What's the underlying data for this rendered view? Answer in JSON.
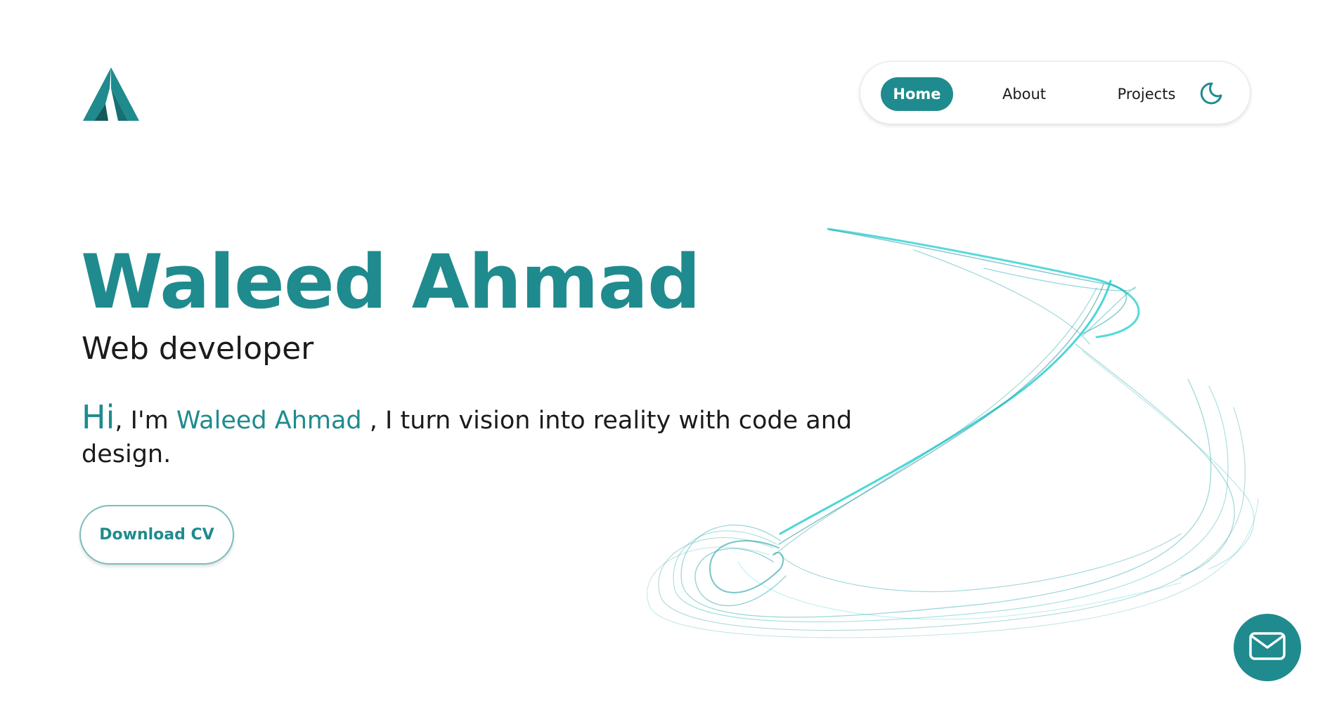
{
  "colors": {
    "accent": "#1f8b8e",
    "text": "#1b1b1b",
    "background": "#ffffff",
    "swirl": "#2ccfd2"
  },
  "logo": {
    "icon": "triangle-a-logo-icon"
  },
  "nav": {
    "items": [
      {
        "label": "Home",
        "active": true
      },
      {
        "label": "About",
        "active": false
      },
      {
        "label": "Projects",
        "active": false
      }
    ],
    "theme_toggle_icon": "moon-icon"
  },
  "hero": {
    "name": "Waleed Ahmad",
    "role": "Web developer",
    "intro": {
      "greeting": "Hi",
      "comma": ",",
      "prefix": " I'm ",
      "name": "Waleed Ahmad",
      "suffix": " , I turn vision into reality with code and design."
    },
    "download_label": "Download CV"
  },
  "decoration": {
    "icon": "swirl-lines-illustration"
  },
  "contact": {
    "icon": "mail-icon"
  }
}
